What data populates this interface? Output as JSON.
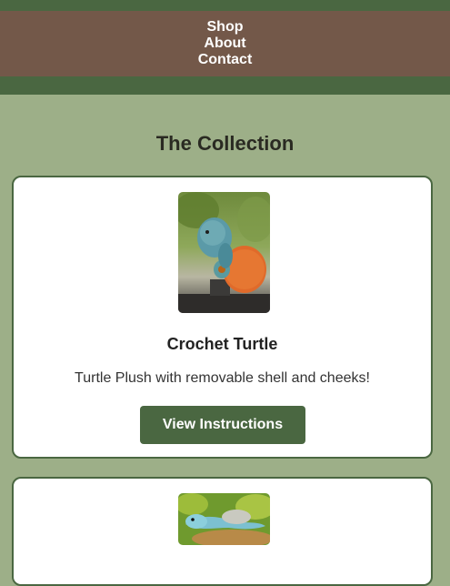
{
  "nav": {
    "links": [
      "Shop",
      "About",
      "Contact"
    ]
  },
  "collection": {
    "title": "The Collection",
    "items": [
      {
        "image_icon": "turtle-plush-photo",
        "title": "Crochet Turtle",
        "description": "Turtle Plush with removable shell and cheeks!",
        "button_label": "View Instructions"
      },
      {
        "image_icon": "lizard-plush-photo"
      }
    ]
  },
  "colors": {
    "page_bg": "#9daf88",
    "header_green": "#4a6741",
    "nav_brown": "#735849",
    "card_bg": "#ffffff",
    "button_bg": "#4a6741"
  }
}
